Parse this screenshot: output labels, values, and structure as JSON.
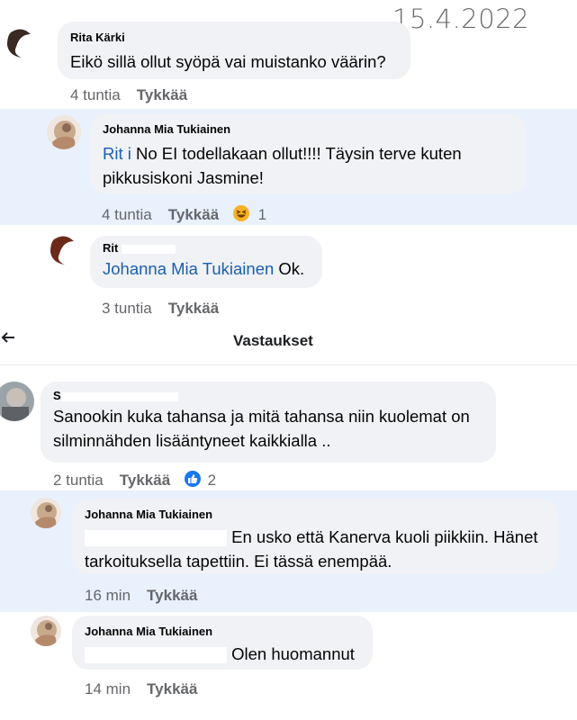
{
  "date_stamp": "15.4.2022",
  "comments": [
    {
      "author": "Rita Kärki",
      "text": "Eikö sillä ollut syöpä vai muistanko väärin?",
      "time": "4 tuntia",
      "like_label": "Tykkää"
    },
    {
      "author": "Johanna Mia Tukiainen",
      "mention": "Rit   i",
      "text_line1": " No EI todellakaan ollut!!!! Täysin terve kuten",
      "text_line2": "pikkusiskoni Jasmine!",
      "time": "4 tuntia",
      "like_label": "Tykkää",
      "reaction_count": "1"
    },
    {
      "author": "Rit  ",
      "mention": "Johanna Mia Tukiainen",
      "text": " Ok.",
      "time": "3 tuntia",
      "like_label": "Tykkää"
    },
    {
      "author": "S",
      "text_line1": "Sanookin kuka tahansa ja mitä tahansa niin kuolemat on",
      "text_line2": "silminnähden lisääntyneet kaikkialla ..",
      "time": "2 tuntia",
      "like_label": "Tykkää",
      "reaction_count": "2"
    },
    {
      "author": "Johanna Mia Tukiainen",
      "text_line1": "En usko että Kanerva kuoli piikkiin. Hänet",
      "text_line2": "tarkoituksella tapettiin. Ei tässä enempää.",
      "time": "16 min",
      "like_label": "Tykkää"
    },
    {
      "author": "Johanna Mia Tukiainen",
      "text": "Olen huomannut",
      "time": "14 min",
      "like_label": "Tykkää"
    }
  ],
  "replies_header": "Vastaukset",
  "icons": {
    "back": "arrow-left-icon",
    "laugh": "laugh-reaction-icon",
    "like": "like-reaction-icon"
  },
  "colors": {
    "highlight": "#e9f1fc",
    "bubble": "#f0f2f5",
    "mention": "#1a5fb4",
    "like_blue": "#1877f2"
  }
}
